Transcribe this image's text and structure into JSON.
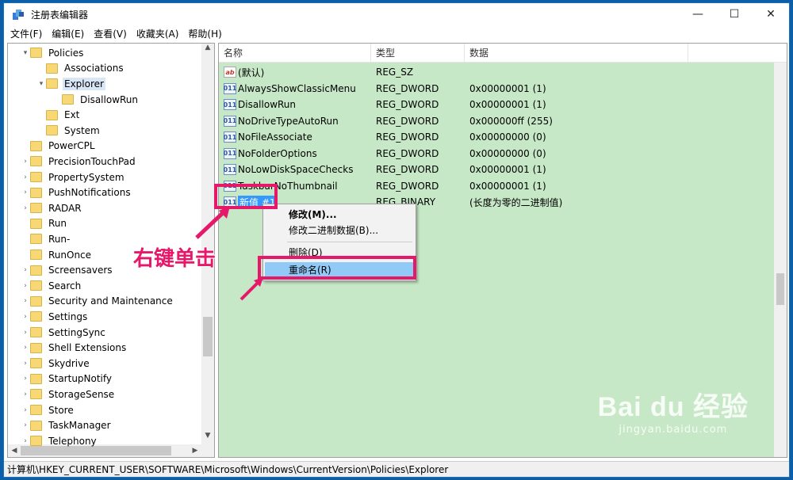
{
  "window": {
    "title": "注册表编辑器",
    "controls": {
      "minimize": "—",
      "maximize": "☐",
      "close": "✕"
    }
  },
  "menu": [
    "文件(F)",
    "编辑(E)",
    "查看(V)",
    "收藏夹(A)",
    "帮助(H)"
  ],
  "tree": [
    {
      "label": "Policies",
      "arrow": "▾",
      "level": 1
    },
    {
      "label": "Associations",
      "arrow": "",
      "level": 2
    },
    {
      "label": "Explorer",
      "arrow": "▾",
      "level": 2,
      "selected": true
    },
    {
      "label": "DisallowRun",
      "arrow": "",
      "level": 3
    },
    {
      "label": "Ext",
      "arrow": "",
      "level": 2
    },
    {
      "label": "System",
      "arrow": "",
      "level": 2
    },
    {
      "label": "PowerCPL",
      "arrow": "",
      "level": 1
    },
    {
      "label": "PrecisionTouchPad",
      "arrow": "›",
      "level": 1
    },
    {
      "label": "PropertySystem",
      "arrow": "›",
      "level": 1
    },
    {
      "label": "PushNotifications",
      "arrow": "›",
      "level": 1
    },
    {
      "label": "RADAR",
      "arrow": "›",
      "level": 1
    },
    {
      "label": "Run",
      "arrow": "",
      "level": 1
    },
    {
      "label": "Run-",
      "arrow": "",
      "level": 1
    },
    {
      "label": "RunOnce",
      "arrow": "",
      "level": 1
    },
    {
      "label": "Screensavers",
      "arrow": "›",
      "level": 1
    },
    {
      "label": "Search",
      "arrow": "›",
      "level": 1
    },
    {
      "label": "Security and Maintenance",
      "arrow": "›",
      "level": 1
    },
    {
      "label": "Settings",
      "arrow": "›",
      "level": 1
    },
    {
      "label": "SettingSync",
      "arrow": "›",
      "level": 1
    },
    {
      "label": "Shell Extensions",
      "arrow": "›",
      "level": 1
    },
    {
      "label": "Skydrive",
      "arrow": "›",
      "level": 1
    },
    {
      "label": "StartupNotify",
      "arrow": "›",
      "level": 1
    },
    {
      "label": "StorageSense",
      "arrow": "›",
      "level": 1
    },
    {
      "label": "Store",
      "arrow": "›",
      "level": 1
    },
    {
      "label": "TaskManager",
      "arrow": "›",
      "level": 1
    },
    {
      "label": "Telephony",
      "arrow": "›",
      "level": 1
    }
  ],
  "columns": [
    "名称",
    "类型",
    "数据"
  ],
  "values": [
    {
      "name": "(默认)",
      "type": "REG_SZ",
      "data": "",
      "icon": "ab"
    },
    {
      "name": "AlwaysShowClassicMenu",
      "type": "REG_DWORD",
      "data": "0x00000001 (1)",
      "icon": "011"
    },
    {
      "name": "DisallowRun",
      "type": "REG_DWORD",
      "data": "0x00000001 (1)",
      "icon": "011"
    },
    {
      "name": "NoDriveTypeAutoRun",
      "type": "REG_DWORD",
      "data": "0x000000ff (255)",
      "icon": "011"
    },
    {
      "name": "NoFileAssociate",
      "type": "REG_DWORD",
      "data": "0x00000000 (0)",
      "icon": "011"
    },
    {
      "name": "NoFolderOptions",
      "type": "REG_DWORD",
      "data": "0x00000000 (0)",
      "icon": "011"
    },
    {
      "name": "NoLowDiskSpaceChecks",
      "type": "REG_DWORD",
      "data": "0x00000001 (1)",
      "icon": "011"
    },
    {
      "name": "TaskbarNoThumbnail",
      "type": "REG_DWORD",
      "data": "0x00000001 (1)",
      "icon": "011"
    },
    {
      "name": "新值 #1",
      "type": "REG_BINARY",
      "data": "(长度为零的二进制值)",
      "icon": "011",
      "selected": true
    }
  ],
  "context_menu": {
    "modify": "修改(M)...",
    "modify_binary": "修改二进制数据(B)...",
    "delete": "删除(D)",
    "rename": "重命名(R)"
  },
  "annotation": {
    "text": "右键单击",
    "color": "#e5186a"
  },
  "status_path": "计算机\\HKEY_CURRENT_USER\\SOFTWARE\\Microsoft\\Windows\\CurrentVersion\\Policies\\Explorer",
  "watermark": {
    "logo": "Bai du 经验",
    "url": "jingyan.baidu.com"
  },
  "colors": {
    "values_bg": "#c6e8c6",
    "selection": "#3399ff",
    "highlight_menu": "#91c9f7",
    "annotation": "#e5186a"
  }
}
